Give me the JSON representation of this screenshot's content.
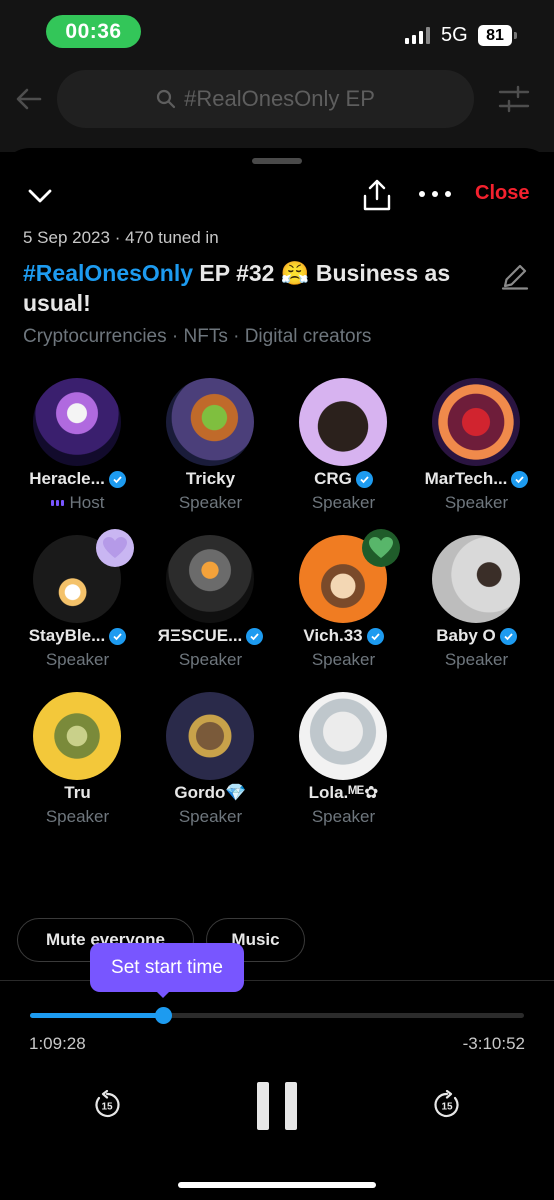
{
  "status_bar": {
    "time": "00:36",
    "network": "5G",
    "battery": "81"
  },
  "search": {
    "query": "#RealOnesOnly EP"
  },
  "space": {
    "close_label": "Close",
    "meta": "5 Sep 2023 · 470 tuned in",
    "title_hashtag": "#RealOnesOnly",
    "title_rest": " EP #32 😤   Business as usual!",
    "topics": "Cryptocurrencies · NFTs · Digital creators"
  },
  "speakers": [
    {
      "name": "Heracle...",
      "role": "Host",
      "verified": true
    },
    {
      "name": "Tricky",
      "role": "Speaker",
      "verified": false
    },
    {
      "name": "CRG",
      "role": "Speaker",
      "verified": true
    },
    {
      "name": "MarTech...",
      "role": "Speaker",
      "verified": true
    },
    {
      "name": "StayBle...",
      "role": "Speaker",
      "verified": true
    },
    {
      "name": "ЯΞSCUE...",
      "role": "Speaker",
      "verified": true
    },
    {
      "name": "Vich.33",
      "role": "Speaker",
      "verified": true
    },
    {
      "name": "Baby O",
      "role": "Speaker",
      "verified": true
    },
    {
      "name": "Tru",
      "role": "Speaker",
      "verified": false
    },
    {
      "name": "Gordo💎",
      "role": "Speaker",
      "verified": false
    },
    {
      "name": "Lola.ᴹᴱ✿",
      "role": "Speaker",
      "verified": false
    }
  ],
  "controls": {
    "mute_label": "Mute everyone",
    "music_label": "Music",
    "tooltip": "Set start time",
    "elapsed": "1:09:28",
    "remaining": "-3:10:52",
    "progress": 0.27,
    "skip_seconds": "15"
  },
  "colors": {
    "accent": "#1d9bf0",
    "host": "#7856ff",
    "close": "#f4212e"
  }
}
